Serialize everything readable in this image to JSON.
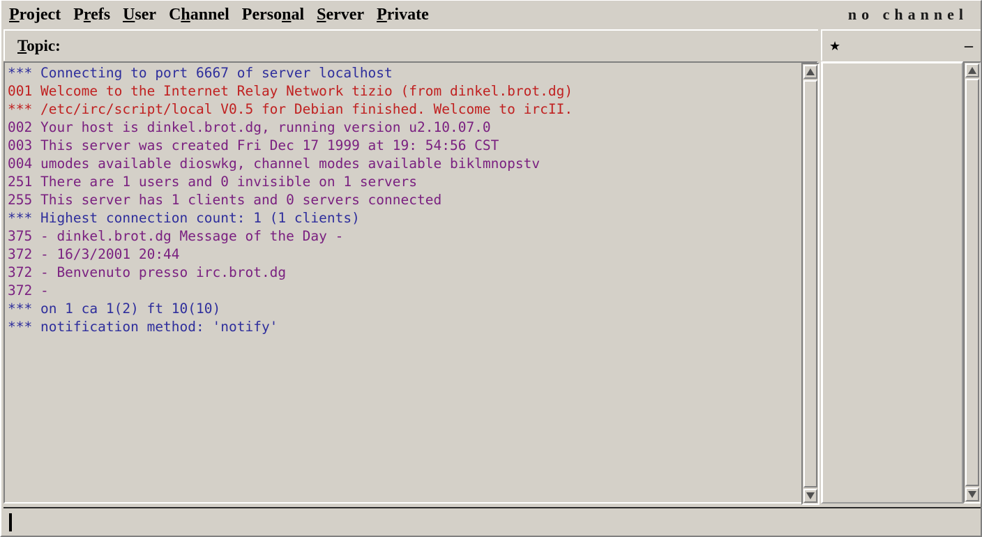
{
  "window": {
    "title": "no channel"
  },
  "menubar": {
    "items": [
      {
        "label": "Project",
        "pre": "",
        "mnemonic": "P",
        "post": "roject"
      },
      {
        "label": "Prefs",
        "pre": "P",
        "mnemonic": "r",
        "post": "efs"
      },
      {
        "label": "User",
        "pre": "",
        "mnemonic": "U",
        "post": "ser"
      },
      {
        "label": "Channel",
        "pre": "C",
        "mnemonic": "h",
        "post": "annel"
      },
      {
        "label": "Personal",
        "pre": "Perso",
        "mnemonic": "n",
        "post": "al"
      },
      {
        "label": "Server",
        "pre": "",
        "mnemonic": "S",
        "post": "erver"
      },
      {
        "label": "Private",
        "pre": "",
        "mnemonic": "P",
        "post": "rivate"
      }
    ],
    "channel_status": "no channel"
  },
  "topic": {
    "label_pre": "",
    "label_mnemonic": "T",
    "label_post": "opic:",
    "value": ""
  },
  "nicklist": {
    "star": "★",
    "dash": "–",
    "entries": []
  },
  "chat": {
    "lines": [
      {
        "text": "*** Connecting to port 6667 of server localhost",
        "color": "blue"
      },
      {
        "text": "001 Welcome to the Internet Relay Network tizio (from dinkel.brot.dg)",
        "color": "red"
      },
      {
        "text": "*** /etc/irc/script/local V0.5 for Debian finished. Welcome to ircII.",
        "color": "red"
      },
      {
        "text": "002 Your host is dinkel.brot.dg, running version u2.10.07.0",
        "color": "purple"
      },
      {
        "text": "003 This server was created Fri Dec 17 1999 at 19: 54:56 CST",
        "color": "purple"
      },
      {
        "text": "004 umodes available dioswkg, channel modes available biklmnopstv",
        "color": "purple"
      },
      {
        "text": "251 There are 1 users and 0 invisible on 1 servers",
        "color": "purple"
      },
      {
        "text": "255 This server has 1 clients and 0 servers connected",
        "color": "purple"
      },
      {
        "text": "*** Highest connection count: 1 (1 clients)",
        "color": "blue"
      },
      {
        "text": "375 - dinkel.brot.dg Message of the Day -",
        "color": "purple"
      },
      {
        "text": "372 - 16/3/2001 20:44",
        "color": "purple"
      },
      {
        "text": "372 - Benvenuto presso irc.brot.dg",
        "color": "purple"
      },
      {
        "text": "372 -",
        "color": "purple"
      },
      {
        "text": "*** on 1 ca 1(2) ft 10(10)",
        "color": "blue"
      },
      {
        "text": "*** notification method: 'notify'",
        "color": "blue"
      }
    ]
  },
  "input": {
    "value": "",
    "placeholder": ""
  },
  "colors": {
    "blue": "#2e2e9c",
    "red": "#c02020",
    "purple": "#7a2080",
    "face": "#d4d0c8",
    "shadow": "#808080",
    "light": "#ffffff"
  },
  "scrollbars": {
    "up_arrow": "up-arrow",
    "down_arrow": "down-arrow"
  }
}
